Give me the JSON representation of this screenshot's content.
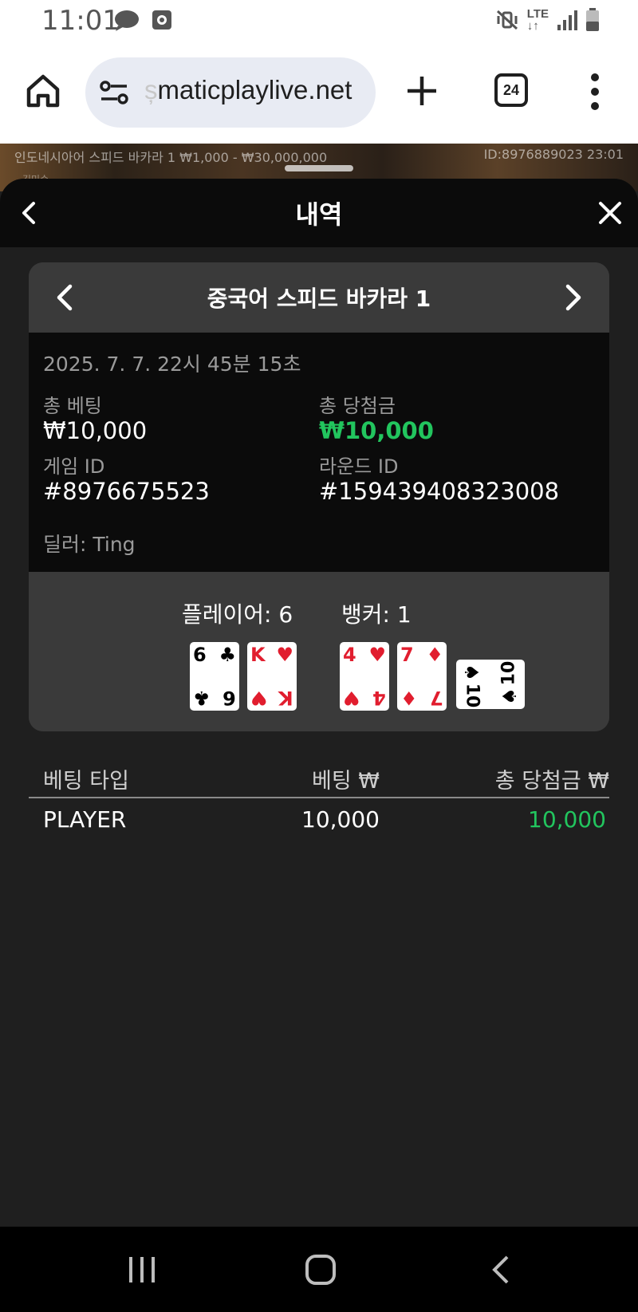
{
  "status_bar": {
    "time": "11:01",
    "left_icons": [
      "cloud-icon",
      "recorder-icon"
    ],
    "right_icons": [
      "mute-vibrate-icon",
      "lte-icon",
      "signal-icon",
      "battery-icon"
    ],
    "lte_label": "LTE"
  },
  "browser": {
    "url_faded": "ș",
    "url": "maticplaylive.net",
    "tab_count": "24"
  },
  "background": {
    "left_text": "인도네시아어 스피드 바카라 1  ₩1,000 - ₩30,000,000",
    "right_text": "ID:8976889023  23:01",
    "sub_text": "김민수"
  },
  "sheet": {
    "title": "내역"
  },
  "round": {
    "game_name": "중국어 스피드 바카라 1",
    "date": "2025. 7. 7. 22시 45분 15초",
    "total_bet_label": "총 베팅",
    "total_bet_value": "₩10,000",
    "total_win_label": "총 당첨금",
    "total_win_value": "₩10,000",
    "game_id_label": "게임 ID",
    "game_id_value": "#8976675523",
    "round_id_label": "라운드 ID",
    "round_id_value": "#159439408323008",
    "dealer": "딜러: Ting",
    "player_label": "플레이어: 6",
    "banker_label": "뱅커: 1"
  },
  "cards": {
    "player": [
      {
        "rank": "6",
        "suit": "♣",
        "color": "#000000"
      },
      {
        "rank": "K",
        "suit": "♥",
        "color": "#e11d2e"
      }
    ],
    "banker": [
      {
        "rank": "4",
        "suit": "♥",
        "color": "#e11d2e"
      },
      {
        "rank": "7",
        "suit": "♦",
        "color": "#e11d2e"
      }
    ],
    "banker_third": {
      "rank": "10",
      "suit": "♠",
      "color": "#000000",
      "rotated": true
    }
  },
  "bets": {
    "headers": [
      "베팅 타입",
      "베팅 ₩",
      "총 당첨금 ₩"
    ],
    "rows": [
      {
        "type": "PLAYER",
        "bet": "10,000",
        "win": "10,000"
      }
    ]
  },
  "colors": {
    "win_green": "#22c55e",
    "card_red": "#e11d2e",
    "sheet_bg": "#1f1f1f",
    "panel_bg": "#3a3a3a"
  }
}
